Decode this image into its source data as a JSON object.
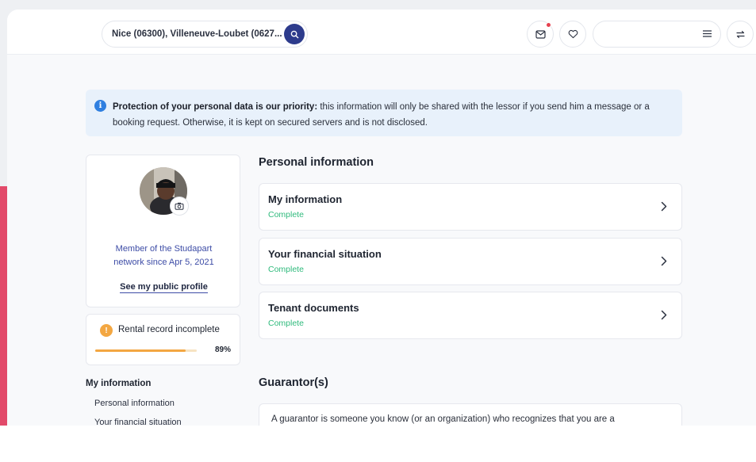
{
  "header": {
    "search_location": "Nice (06300), Villeneuve-Loubet (0627...",
    "icons": {
      "search": "search-icon",
      "messages": "mail-icon",
      "favorites": "heart-icon",
      "menu": "hamburger-icon",
      "switch": "swap-icon"
    },
    "has_notification": true
  },
  "banner": {
    "bold_text": "Protection of your personal data is our priority:",
    "text": " this information will only be shared with the lessor if you send him a message or a booking request. Otherwise, it is kept on secured servers and is not disclosed."
  },
  "profile": {
    "member_line1": "Member of the Studapart",
    "member_line2": "network since Apr 5, 2021",
    "public_profile_link": "See my public profile"
  },
  "rental_record": {
    "title": "Rental record incomplete",
    "progress_fraction": 0.89,
    "progress_label": "89%"
  },
  "side_nav": {
    "title": "My information",
    "items": [
      "Personal information",
      "Your financial situation"
    ]
  },
  "personal_information": {
    "title": "Personal information",
    "cards": [
      {
        "title": "My information",
        "status": "Complete"
      },
      {
        "title": "Your financial situation",
        "status": "Complete"
      },
      {
        "title": "Tenant documents",
        "status": "Complete"
      }
    ]
  },
  "guarantors": {
    "title": "Guarantor(s)",
    "description": "A guarantor is someone you know (or an organization) who recognizes that you are a"
  },
  "colors": {
    "brand_navy": "#2d3b8c",
    "accent_pink": "#e24a6a",
    "complete_green": "#2fba7c",
    "warning_orange": "#f3a742",
    "info_blue": "#2f7fe0"
  }
}
